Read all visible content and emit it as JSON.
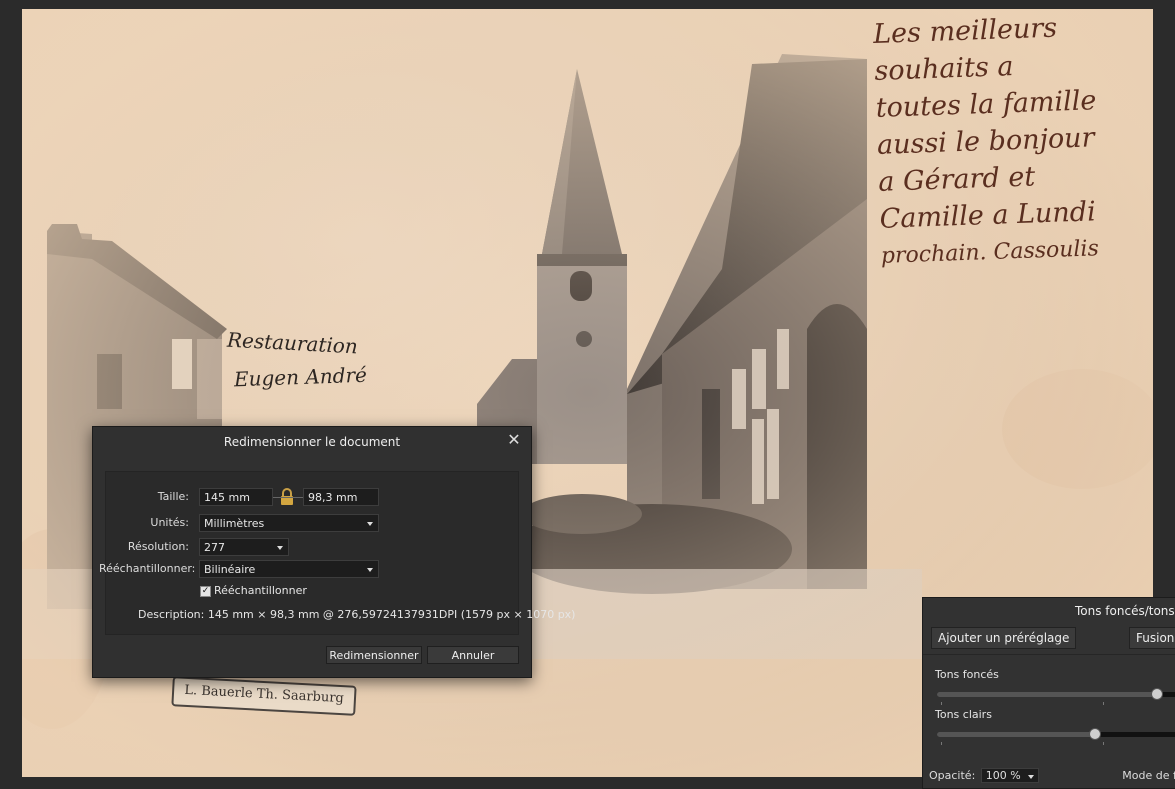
{
  "canvas": {
    "handwriting_lines": [
      "Les meilleurs",
      "souhaits a",
      "toutes la famille",
      "aussi le bonjour",
      "a Gérard et",
      "Camille a Lundi",
      "prochain. Cassoulis"
    ],
    "sign_line1": "Restauration",
    "sign_line2": "Eugen André",
    "banner_text": "L. Bauerle Th. Saarburg"
  },
  "dialog": {
    "title": "Redimensionner le document",
    "close_icon": "close-icon",
    "size_label": "Taille:",
    "width_value": "145 mm",
    "height_value": "98,3 mm",
    "lock_icon": "lock-icon",
    "units_label": "Unités:",
    "units_value": "Millimètres",
    "resolution_label": "Résolution:",
    "resolution_value": "277",
    "resample_label": "Rééchantillonner:",
    "resample_value": "Bilinéaire",
    "resample_checkbox_label": "Rééchantillonner",
    "resample_checked": true,
    "description": "Description: 145 mm × 98,3 mm @ 276,59724137931DPI (1579 px × 1070 px)",
    "resize_button": "Redimensionner",
    "cancel_button": "Annuler"
  },
  "adjustment": {
    "title": "Tons foncés/tons clairs",
    "add_preset_button": "Ajouter un préréglage",
    "blend_button": "Fusionner",
    "shadows_label": "Tons foncés",
    "shadows_value": 0.93,
    "highlights_label": "Tons clairs",
    "highlights_value": 0.66,
    "opacity_label": "Opacité:",
    "opacity_value": "100 %",
    "blend_mode_label": "Mode de fusion"
  },
  "colors": {
    "panel": "#303030",
    "paper": "#ecd3b7",
    "ink": "#5a2e1f"
  }
}
